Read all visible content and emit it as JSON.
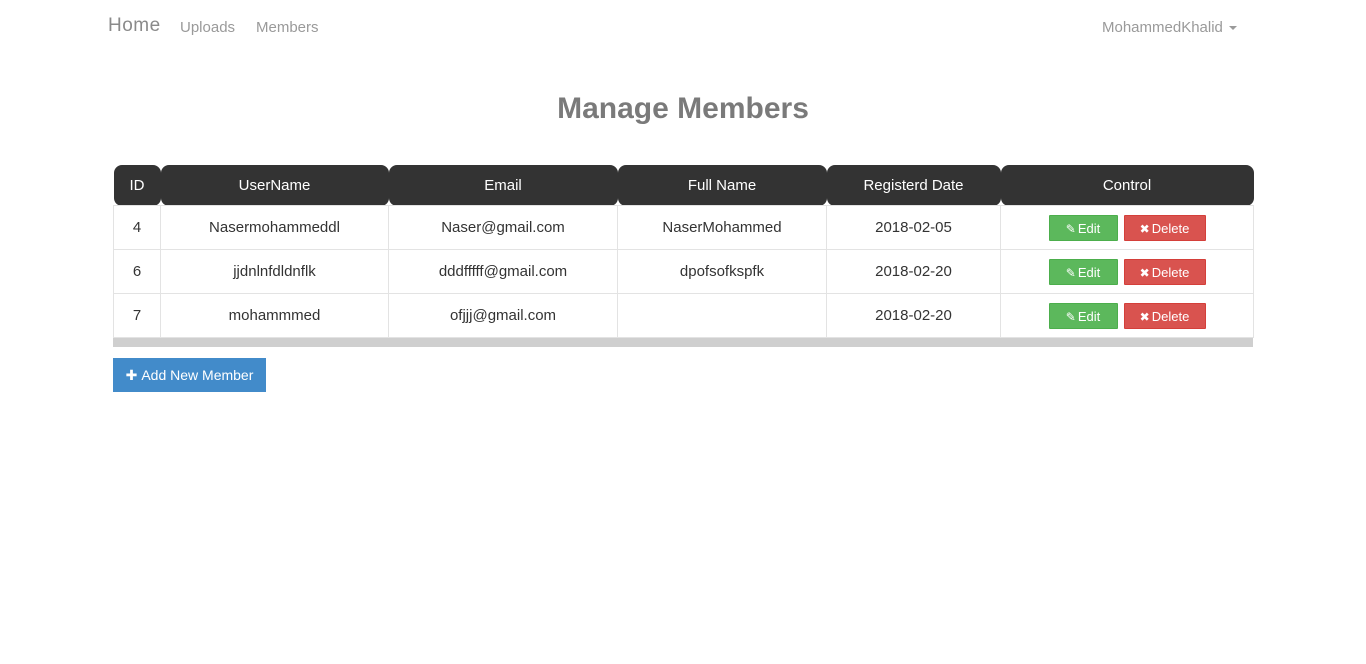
{
  "nav": {
    "brand": "Home",
    "links": [
      "Uploads",
      "Members"
    ],
    "user": "MohammedKhalid"
  },
  "page": {
    "title": "Manage Members"
  },
  "table": {
    "headers": [
      "ID",
      "UserName",
      "Email",
      "Full Name",
      "Registerd Date",
      "Control"
    ],
    "rows": [
      {
        "id": "4",
        "username": "Nasermohammeddl",
        "email": "Naser@gmail.com",
        "fullname": "NaserMohammed",
        "date": "2018-02-05"
      },
      {
        "id": "6",
        "username": "jjdnlnfdldnflk",
        "email": "dddfffff@gmail.com",
        "fullname": "dpofsofkspfk",
        "date": "2018-02-20"
      },
      {
        "id": "7",
        "username": "mohammmed",
        "email": "ofjjj@gmail.com",
        "fullname": "",
        "date": "2018-02-20"
      }
    ],
    "edit_label": "Edit",
    "delete_label": "Delete"
  },
  "actions": {
    "add_label": "Add New Member"
  },
  "icons": {
    "edit": "edit-icon",
    "delete": "delete-icon",
    "add": "plus-icon",
    "caret": "caret-down-icon"
  },
  "colors": {
    "header_bg": "#333333",
    "edit_green": "#5cb85c",
    "delete_red": "#d9534f",
    "primary_blue": "#428bca"
  }
}
